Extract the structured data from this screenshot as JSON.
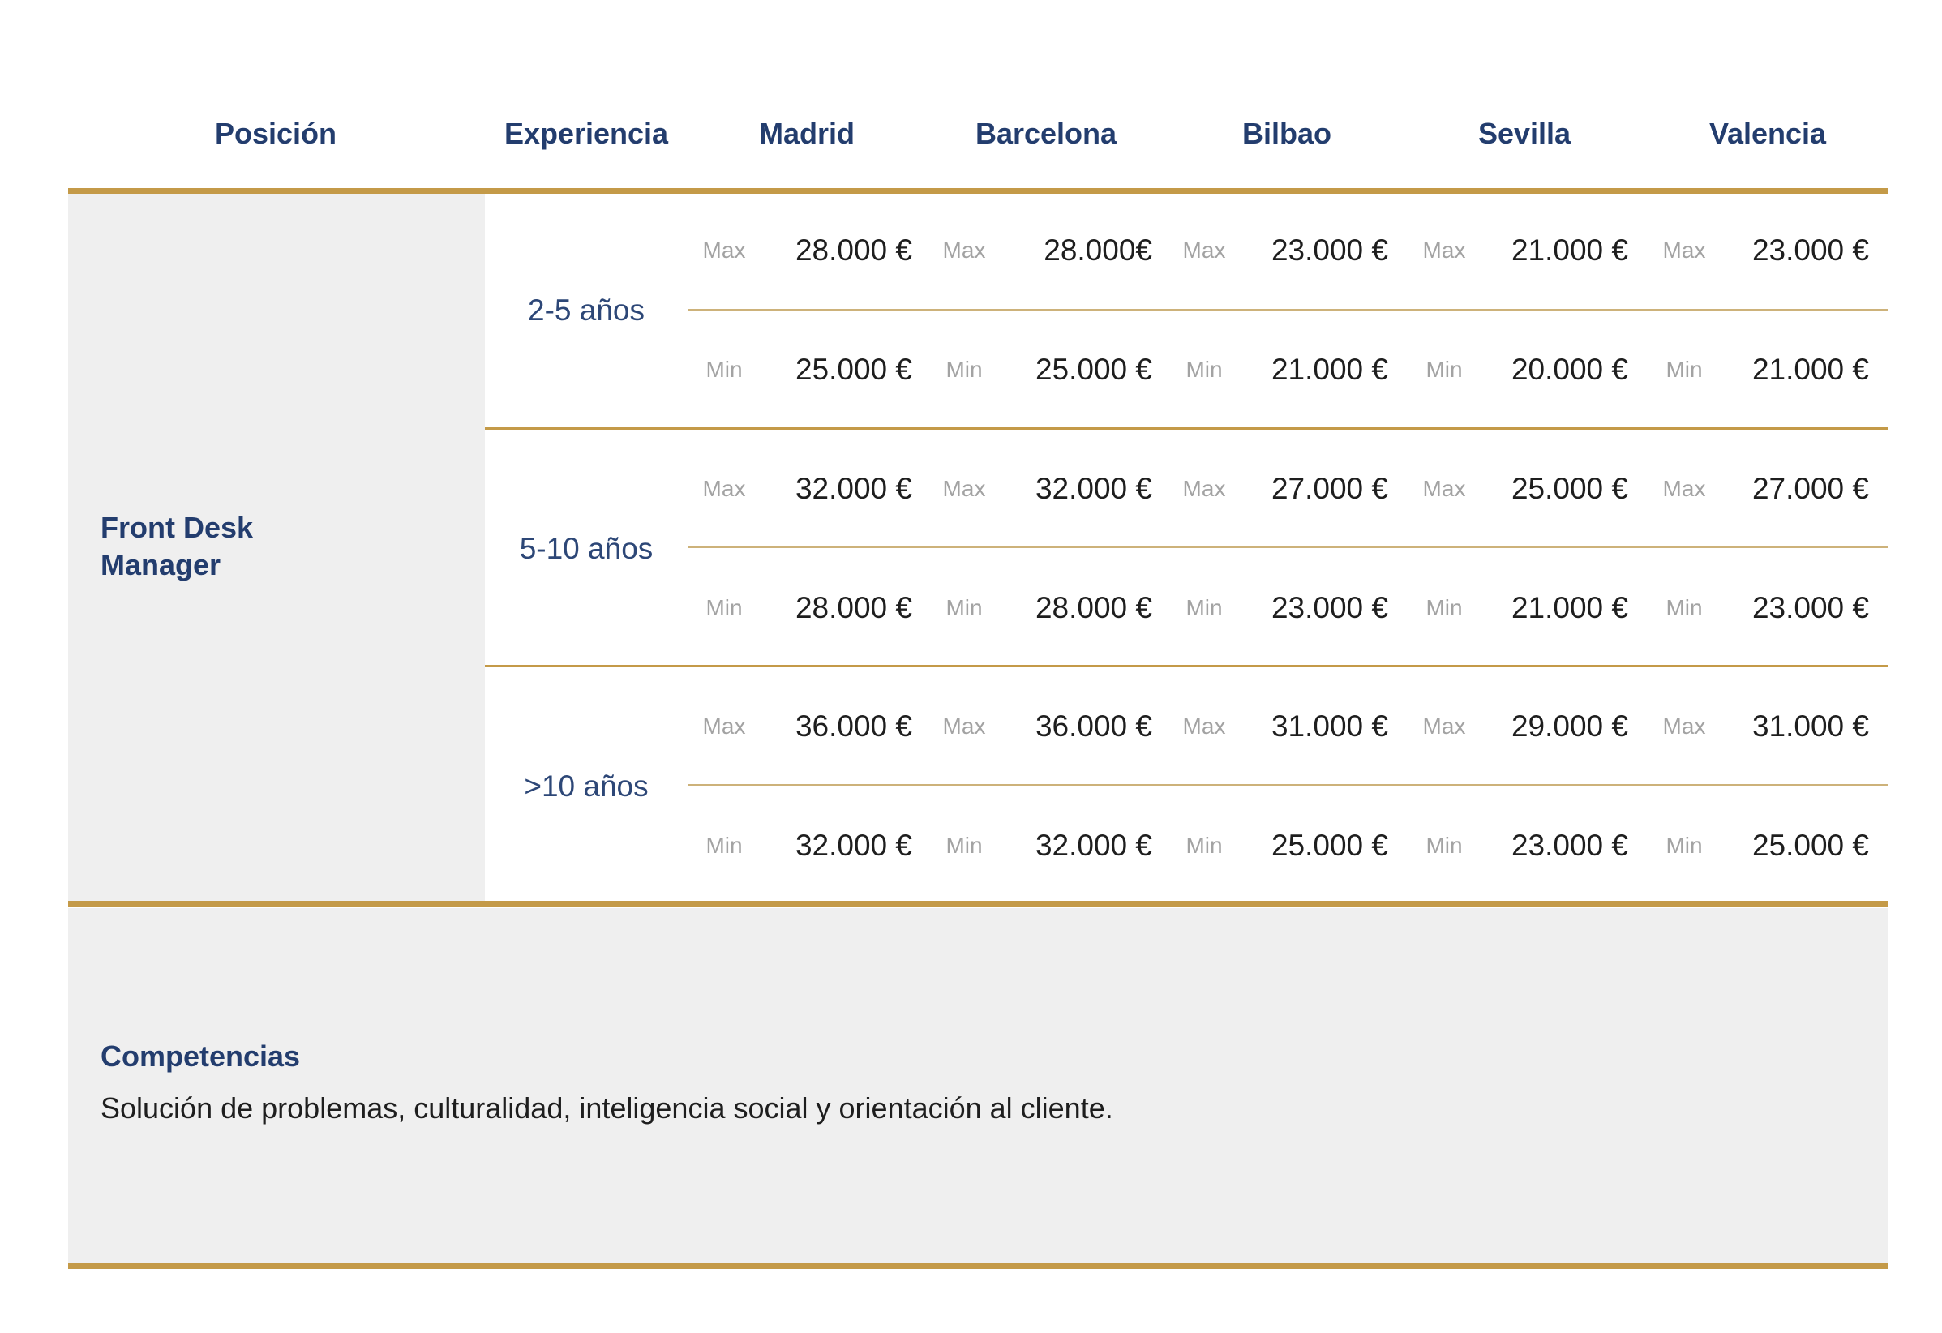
{
  "header": {
    "position": "Posición",
    "experience": "Experiencia",
    "cities": [
      "Madrid",
      "Barcelona",
      "Bilbao",
      "Sevilla",
      "Valencia"
    ]
  },
  "position": {
    "line1": "Front Desk",
    "line2": "Manager"
  },
  "labels": {
    "max": "Max",
    "min": "Min"
  },
  "groups": [
    {
      "experience": "2-5 años",
      "max": [
        "28.000 €",
        "28.000€",
        "23.000 €",
        "21.000 €",
        "23.000 €"
      ],
      "min": [
        "25.000 €",
        "25.000 €",
        "21.000 €",
        "20.000 €",
        "21.000 €"
      ]
    },
    {
      "experience": "5-10 años",
      "max": [
        "32.000 €",
        "32.000 €",
        "27.000 €",
        "25.000 €",
        "27.000 €"
      ],
      "min": [
        "28.000 €",
        "28.000 €",
        "23.000 €",
        "21.000 €",
        "23.000 €"
      ]
    },
    {
      "experience": ">10 años",
      "max": [
        "36.000 €",
        "36.000 €",
        "31.000 €",
        "29.000 €",
        "31.000 €"
      ],
      "min": [
        "32.000 €",
        "32.000 €",
        "25.000 €",
        "23.000 €",
        "25.000 €"
      ]
    }
  ],
  "competencias": {
    "title": "Competencias",
    "text": "Solución de problemas, culturalidad, inteligencia social y orientación al cliente."
  },
  "colors": {
    "navy": "#233d6e",
    "gold": "#c49a48",
    "panel": "#efefef",
    "muted": "#a3a3a3"
  }
}
